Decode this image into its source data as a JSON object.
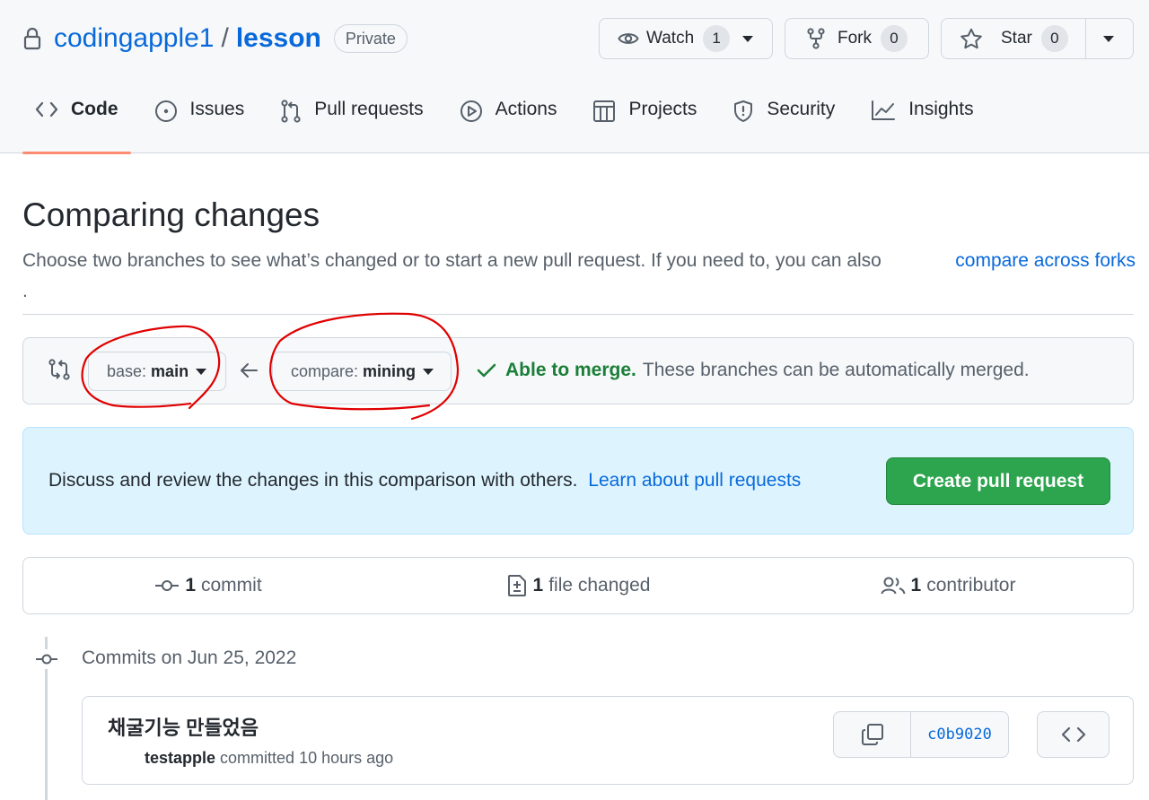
{
  "repo": {
    "owner": "codingapple1",
    "separator": "/",
    "name": "lesson",
    "visibility": "Private"
  },
  "actions": {
    "watch": {
      "label": "Watch",
      "count": "1"
    },
    "fork": {
      "label": "Fork",
      "count": "0"
    },
    "star": {
      "label": "Star",
      "count": "0"
    }
  },
  "nav": {
    "tabs": [
      {
        "label": "Code",
        "icon": "code-icon",
        "selected": true
      },
      {
        "label": "Issues",
        "icon": "issue-icon"
      },
      {
        "label": "Pull requests",
        "icon": "pull-request-icon"
      },
      {
        "label": "Actions",
        "icon": "play-icon"
      },
      {
        "label": "Projects",
        "icon": "table-icon"
      },
      {
        "label": "Security",
        "icon": "shield-icon"
      },
      {
        "label": "Insights",
        "icon": "graph-icon"
      }
    ]
  },
  "page": {
    "title": "Comparing changes",
    "description": "Choose two branches to see what’s changed or to start a new pull request. If you need to, you can also",
    "forks_link": "compare across forks",
    "trailing": "."
  },
  "range": {
    "base_prefix": "base:",
    "base_branch": "main",
    "compare_prefix": "compare:",
    "compare_branch": "mining",
    "merge_ok": "Able to merge.",
    "merge_text": "These branches can be automatically merged."
  },
  "flash": {
    "text": "Discuss and review the changes in this comparison with others.",
    "link": "Learn about pull requests",
    "button": "Create pull request"
  },
  "summary": {
    "commits_count": "1",
    "commits_label": "commit",
    "files_count": "1",
    "files_label": "file changed",
    "contributors_count": "1",
    "contributors_label": "contributor"
  },
  "commits": {
    "date_heading": "Commits on Jun 25, 2022",
    "items": [
      {
        "message": "채굴기능 만들었음",
        "author": "testapple",
        "meta": "committed 10 hours ago",
        "sha": "c0b9020"
      }
    ]
  },
  "colors": {
    "link": "#0969da",
    "success": "#1a7f37",
    "primary_button": "#2da44e",
    "flash_bg": "#ddf4ff",
    "annotation": "#e00000",
    "tab_underline": "#fd8c73"
  }
}
